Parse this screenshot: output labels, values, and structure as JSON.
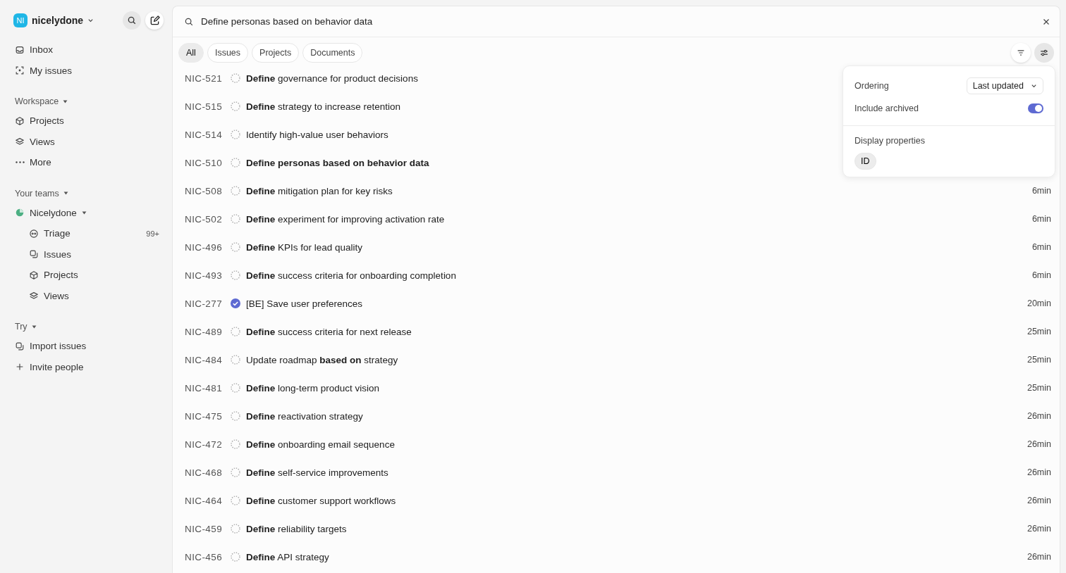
{
  "workspace": {
    "initials": "NI",
    "name": "nicelydone"
  },
  "sidebar": {
    "top_items": [
      {
        "label": "Inbox"
      },
      {
        "label": "My issues"
      }
    ],
    "sections": [
      {
        "title": "Workspace",
        "items": [
          {
            "label": "Projects"
          },
          {
            "label": "Views"
          },
          {
            "label": "More"
          }
        ]
      },
      {
        "title": "Your teams",
        "team": {
          "name": "Nicelydone",
          "items": [
            {
              "label": "Triage",
              "count": "99+"
            },
            {
              "label": "Issues"
            },
            {
              "label": "Projects"
            },
            {
              "label": "Views"
            }
          ]
        }
      },
      {
        "title": "Try",
        "items": [
          {
            "label": "Import issues"
          },
          {
            "label": "Invite people"
          }
        ]
      }
    ]
  },
  "search": {
    "value": "Define personas based on behavior data"
  },
  "tabs": [
    {
      "label": "All",
      "selected": true
    },
    {
      "label": "Issues",
      "selected": false
    },
    {
      "label": "Projects",
      "selected": false
    },
    {
      "label": "Documents",
      "selected": false
    }
  ],
  "results": [
    {
      "id": "NIC-521",
      "completed": false,
      "title": "**Define** governance for product decisions"
    },
    {
      "id": "NIC-515",
      "completed": false,
      "title": "**Define** strategy to increase retention"
    },
    {
      "id": "NIC-514",
      "completed": false,
      "title": "Identify high-value user behaviors"
    },
    {
      "id": "NIC-510",
      "completed": false,
      "title": "**Define personas based on behavior data**"
    },
    {
      "id": "NIC-508",
      "completed": false,
      "title": "**Define** mitigation plan for key risks",
      "time": "6min"
    },
    {
      "id": "NIC-502",
      "completed": false,
      "title": "**Define** experiment for improving activation rate",
      "time": "6min"
    },
    {
      "id": "NIC-496",
      "completed": false,
      "title": "**Define** KPIs for lead quality",
      "time": "6min"
    },
    {
      "id": "NIC-493",
      "completed": false,
      "title": "**Define** success criteria for onboarding completion",
      "time": "6min"
    },
    {
      "id": "NIC-277",
      "completed": true,
      "title": "[BE] Save user preferences",
      "time": "20min"
    },
    {
      "id": "NIC-489",
      "completed": false,
      "title": "**Define** success criteria for next release",
      "time": "25min"
    },
    {
      "id": "NIC-484",
      "completed": false,
      "title": "Update roadmap **based on** strategy",
      "time": "25min"
    },
    {
      "id": "NIC-481",
      "completed": false,
      "title": "**Define** long-term product vision",
      "time": "25min"
    },
    {
      "id": "NIC-475",
      "completed": false,
      "title": "**Define** reactivation strategy",
      "time": "26min"
    },
    {
      "id": "NIC-472",
      "completed": false,
      "title": "**Define** onboarding email sequence",
      "time": "26min"
    },
    {
      "id": "NIC-468",
      "completed": false,
      "title": "**Define** self-service improvements",
      "time": "26min"
    },
    {
      "id": "NIC-464",
      "completed": false,
      "title": "**Define** customer support workflows",
      "time": "26min"
    },
    {
      "id": "NIC-459",
      "completed": false,
      "title": "**Define** reliability targets",
      "time": "26min"
    },
    {
      "id": "NIC-456",
      "completed": false,
      "title": "**Define** API strategy",
      "time": "26min"
    }
  ],
  "display_popover": {
    "ordering_label": "Ordering",
    "ordering_value": "Last updated",
    "archived_label": "Include archived",
    "include_archived": true,
    "properties_title": "Display properties",
    "properties": [
      {
        "label": "ID",
        "selected": true
      }
    ]
  }
}
